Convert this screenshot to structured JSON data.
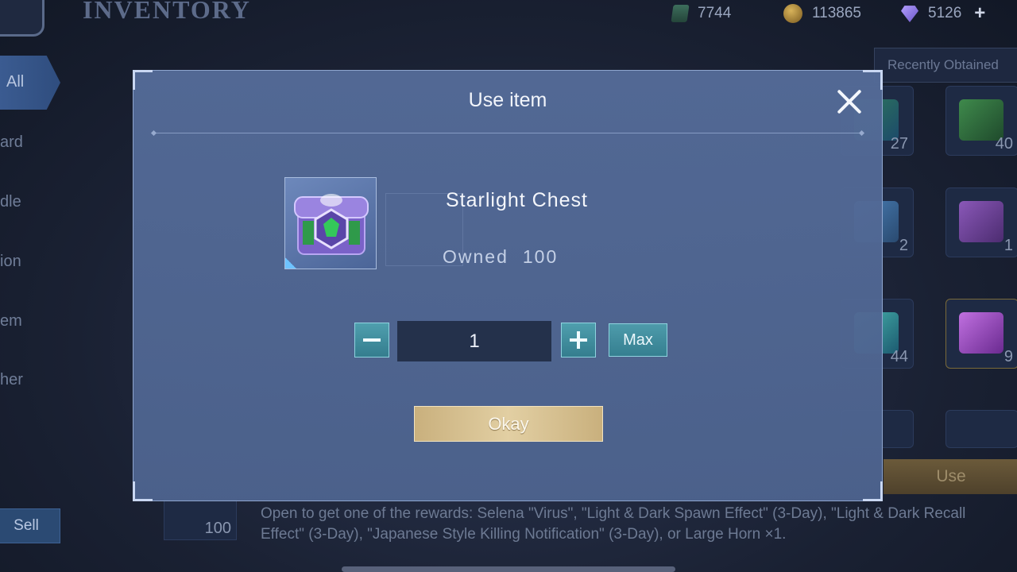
{
  "header": {
    "title": "INVENTORY",
    "currencies": [
      {
        "icon": "battle-point-ticket-icon",
        "value": "7744"
      },
      {
        "icon": "gold-coin-icon",
        "value": "113865"
      },
      {
        "icon": "diamond-icon",
        "value": "5126"
      }
    ],
    "add_label": "+"
  },
  "sidebar": {
    "items": [
      {
        "label": "All"
      },
      {
        "label": "ard"
      },
      {
        "label": "dle"
      },
      {
        "label": "ion"
      },
      {
        "label": "em"
      },
      {
        "label": "her"
      }
    ],
    "sell_label": "Sell"
  },
  "right_panel": {
    "recent_label": "Recently Obtained",
    "counts": [
      "27",
      "40",
      "2",
      "1",
      "44",
      "9"
    ],
    "use_label": "Use"
  },
  "selected_item": {
    "count": "100",
    "description": "Open to get one of the rewards: Selena \"Virus\", \"Light & Dark Spawn Effect\" (3-Day), \"Light & Dark Recall Effect\" (3-Day), \"Japanese Style Killing Notification\" (3-Day), or Large Horn ×1."
  },
  "modal": {
    "title": "Use item",
    "item_name": "Starlight Chest",
    "owned_label": "Owned",
    "owned_value": "100",
    "quantity": "1",
    "max_label": "Max",
    "okay_label": "Okay"
  }
}
